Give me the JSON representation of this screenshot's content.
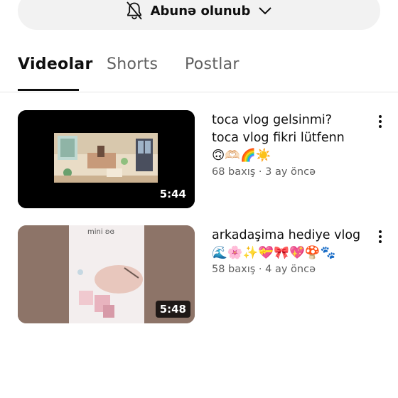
{
  "subscribe": {
    "label": "Abunə olunub",
    "bell_icon": "bell-off-icon",
    "chevron_icon": "chevron-down-icon"
  },
  "tabs": [
    {
      "label": "Videolar",
      "active": true
    },
    {
      "label": "Shorts",
      "active": false
    },
    {
      "label": "Postlar",
      "active": false
    }
  ],
  "videos": [
    {
      "title_line1": "toca vlog gelsinmi?",
      "title_line2": "toca vlog fikri lütfenn",
      "title_line3": "🙃🫶🏻🌈☀️",
      "meta": "68 baxış · 3 ay öncə",
      "duration": "5:44"
    },
    {
      "title_line1": "arkadaşima hediye vlog",
      "title_line2": "🌊🌸✨💝🎀💖🍄🐾",
      "meta": "58 baxış · 4 ay öncə",
      "duration": "5:48",
      "thumb_text": "mini ʚɞ"
    }
  ],
  "colors": {
    "accent": "#0f0f0f",
    "secondary_text": "#606060",
    "pill_bg": "#f2f2f2"
  }
}
